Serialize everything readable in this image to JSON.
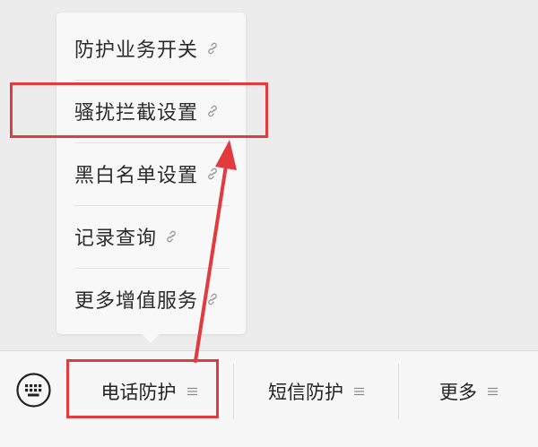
{
  "popup_menu": {
    "items": [
      {
        "label": "防护业务开关",
        "icon": "link-icon"
      },
      {
        "label": "骚扰拦截设置",
        "icon": "link-icon"
      },
      {
        "label": "黑白名单设置",
        "icon": "link-icon"
      },
      {
        "label": "记录查询",
        "icon": "link-icon"
      },
      {
        "label": "更多增值服务",
        "icon": "link-icon"
      }
    ]
  },
  "bottom_bar": {
    "keyboard_icon": "keyboard-icon",
    "tabs": [
      {
        "label": "电话防护",
        "icon": "menu-lines-icon"
      },
      {
        "label": "短信防护",
        "icon": "menu-lines-icon"
      },
      {
        "label": "更多",
        "icon": "menu-lines-icon"
      }
    ]
  },
  "annotation": {
    "color": "#e23a3d"
  }
}
